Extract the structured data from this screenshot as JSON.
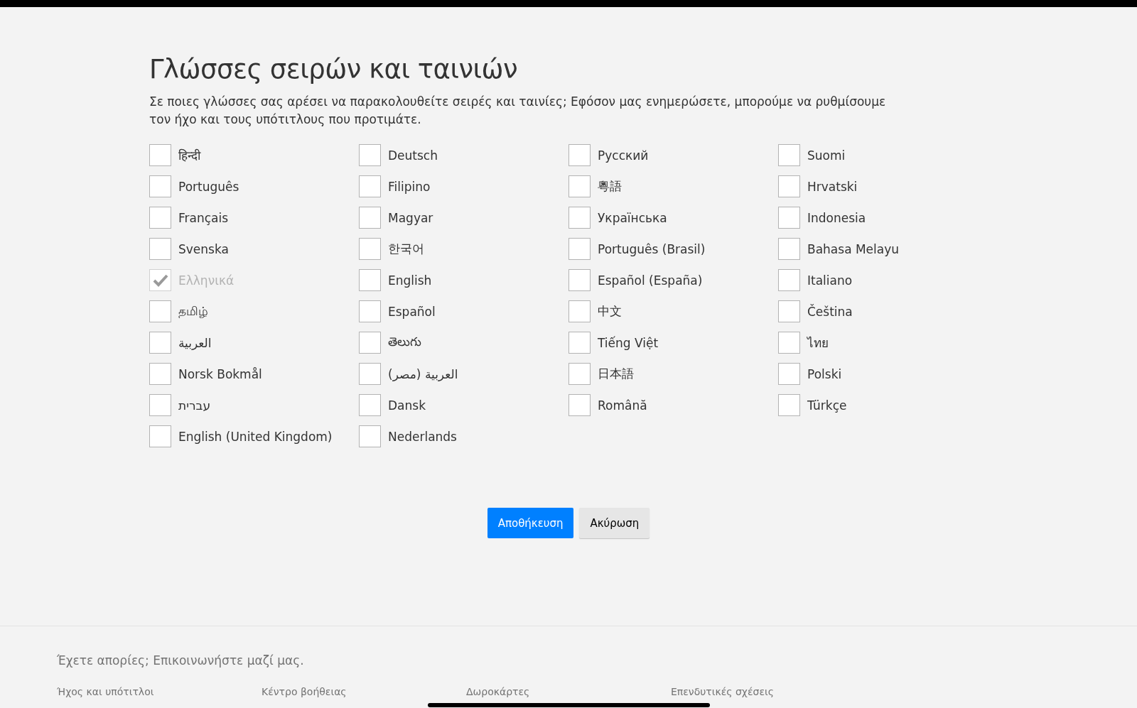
{
  "title": "Γλώσσες σειρών και ταινιών",
  "description": "Σε ποιες γλώσσες σας αρέσει να παρακολουθείτε σειρές και ταινίες; Εφόσον μας ενημερώσετε, μπορούμε να ρυθμίσουμε τον ήχο και τους υπότιτλους που προτιμάτε.",
  "languages": [
    [
      {
        "label": "हिन्दी",
        "checked": false,
        "disabled": false
      },
      {
        "label": "Português",
        "checked": false,
        "disabled": false
      },
      {
        "label": "Français",
        "checked": false,
        "disabled": false
      },
      {
        "label": "Svenska",
        "checked": false,
        "disabled": false
      },
      {
        "label": "Ελληνικά",
        "checked": true,
        "disabled": true
      },
      {
        "label": "தமிழ்",
        "checked": false,
        "disabled": false
      },
      {
        "label": "العربية",
        "checked": false,
        "disabled": false
      },
      {
        "label": "Norsk Bokmål",
        "checked": false,
        "disabled": false
      },
      {
        "label": "עברית",
        "checked": false,
        "disabled": false
      },
      {
        "label": "English (United Kingdom)",
        "checked": false,
        "disabled": false
      }
    ],
    [
      {
        "label": "Deutsch",
        "checked": false,
        "disabled": false
      },
      {
        "label": "Filipino",
        "checked": false,
        "disabled": false
      },
      {
        "label": "Magyar",
        "checked": false,
        "disabled": false
      },
      {
        "label": "한국어",
        "checked": false,
        "disabled": false
      },
      {
        "label": "English",
        "checked": false,
        "disabled": false
      },
      {
        "label": "Español",
        "checked": false,
        "disabled": false
      },
      {
        "label": "తెలుగు",
        "checked": false,
        "disabled": false
      },
      {
        "label": "العربية (مصر)",
        "checked": false,
        "disabled": false
      },
      {
        "label": "Dansk",
        "checked": false,
        "disabled": false
      },
      {
        "label": "Nederlands",
        "checked": false,
        "disabled": false
      }
    ],
    [
      {
        "label": "Русский",
        "checked": false,
        "disabled": false
      },
      {
        "label": "粵語",
        "checked": false,
        "disabled": false
      },
      {
        "label": "Українська",
        "checked": false,
        "disabled": false
      },
      {
        "label": "Português (Brasil)",
        "checked": false,
        "disabled": false
      },
      {
        "label": "Español (España)",
        "checked": false,
        "disabled": false
      },
      {
        "label": "中文",
        "checked": false,
        "disabled": false
      },
      {
        "label": "Tiếng Việt",
        "checked": false,
        "disabled": false
      },
      {
        "label": "日本語",
        "checked": false,
        "disabled": false
      },
      {
        "label": "Română",
        "checked": false,
        "disabled": false
      }
    ],
    [
      {
        "label": "Suomi",
        "checked": false,
        "disabled": false
      },
      {
        "label": "Hrvatski",
        "checked": false,
        "disabled": false
      },
      {
        "label": "Indonesia",
        "checked": false,
        "disabled": false
      },
      {
        "label": "Bahasa Melayu",
        "checked": false,
        "disabled": false
      },
      {
        "label": "Italiano",
        "checked": false,
        "disabled": false
      },
      {
        "label": "Čeština",
        "checked": false,
        "disabled": false
      },
      {
        "label": "ไทย",
        "checked": false,
        "disabled": false
      },
      {
        "label": "Polski",
        "checked": false,
        "disabled": false
      },
      {
        "label": "Türkçe",
        "checked": false,
        "disabled": false
      }
    ]
  ],
  "buttons": [
    {
      "label": "Αποθήκευση",
      "kind": "primary"
    },
    {
      "label": "Ακύρωση",
      "kind": "secondary"
    }
  ],
  "footer": {
    "contact": "Έχετε απορίες; Επικοινωνήστε μαζί μας.",
    "links": [
      "Ήχος και υπότιτλοι",
      "Κέντρο βοήθειας",
      "Δωροκάρτες",
      "Επενδυτικές σχέσεις"
    ]
  }
}
